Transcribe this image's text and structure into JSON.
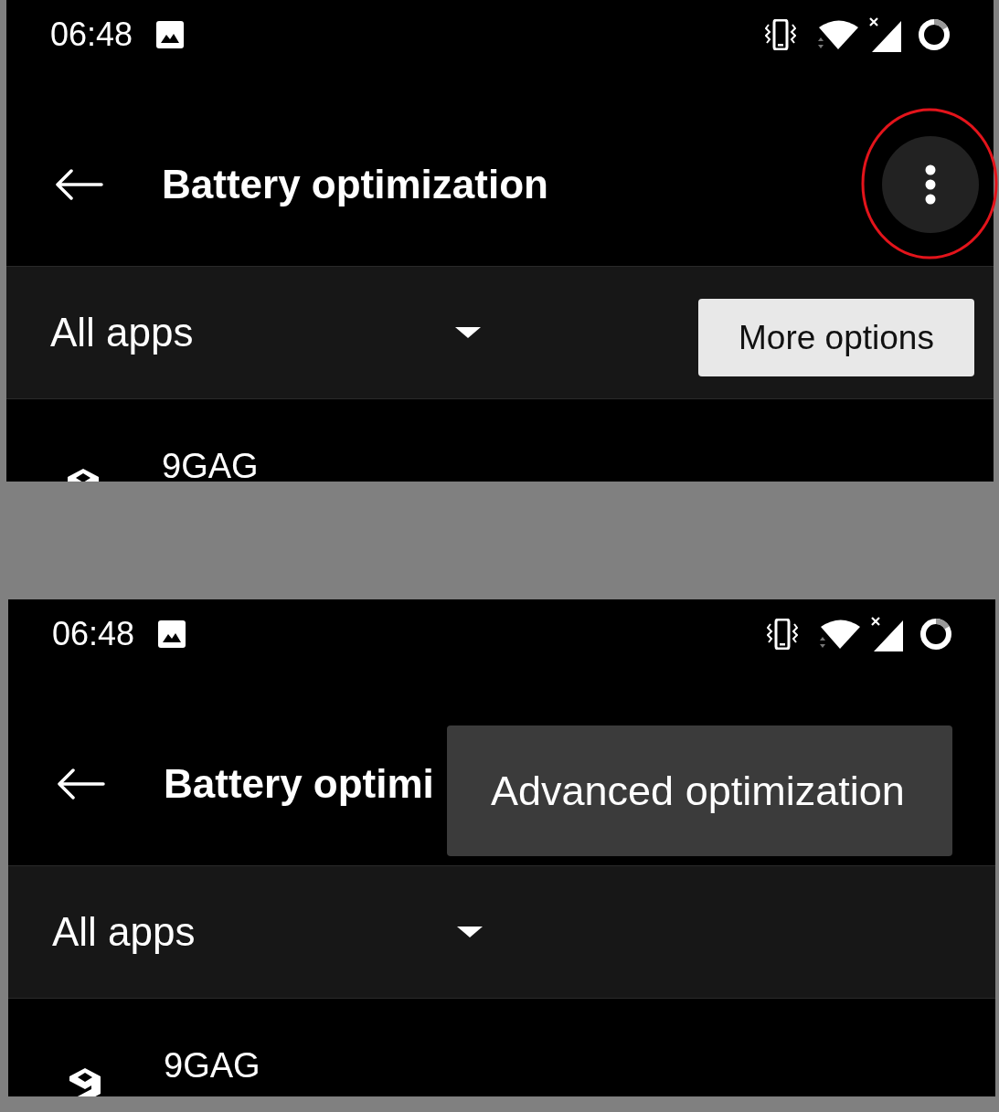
{
  "screens": [
    {
      "status_bar": {
        "time": "06:48"
      },
      "app_bar": {
        "title": "Battery optimization",
        "menu_button": {
          "pressed": true,
          "circled": true
        }
      },
      "tooltip": {
        "text": "More options"
      },
      "filter": {
        "label": "All apps"
      },
      "apps": [
        {
          "name": "9GAG"
        }
      ]
    },
    {
      "status_bar": {
        "time": "06:48"
      },
      "app_bar": {
        "title": "Battery optimi"
      },
      "menu": {
        "items": [
          {
            "label": "Advanced optimization"
          }
        ]
      },
      "filter": {
        "label": "All apps"
      },
      "apps": [
        {
          "name": "9GAG"
        }
      ]
    }
  ]
}
